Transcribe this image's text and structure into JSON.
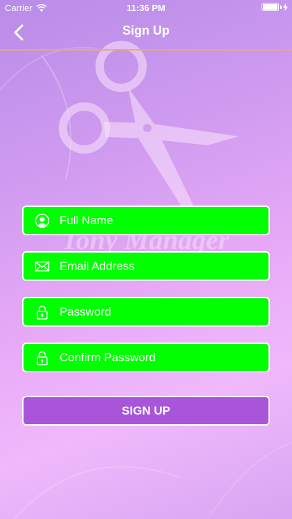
{
  "status_bar": {
    "carrier": "Carrier",
    "time": "11:36 PM",
    "battery_level": 1.0
  },
  "nav": {
    "title": "Sign Up",
    "back_icon": "chevron-left-icon"
  },
  "background": {
    "watermark_icon": "scissors-icon",
    "watermark_text": "Tony Manager"
  },
  "form": {
    "fields": [
      {
        "placeholder": "Full Name",
        "icon": "user-icon"
      },
      {
        "placeholder": "Email Address",
        "icon": "envelope-icon"
      },
      {
        "placeholder": "Password",
        "icon": "lock-icon"
      },
      {
        "placeholder": "Confirm Password",
        "icon": "lock-icon"
      }
    ],
    "submit_label": "SIGN UP"
  },
  "colors": {
    "field_bg": "#00ff00",
    "button_bg": "#a855d9",
    "nav_divider": "#f7a65b"
  }
}
